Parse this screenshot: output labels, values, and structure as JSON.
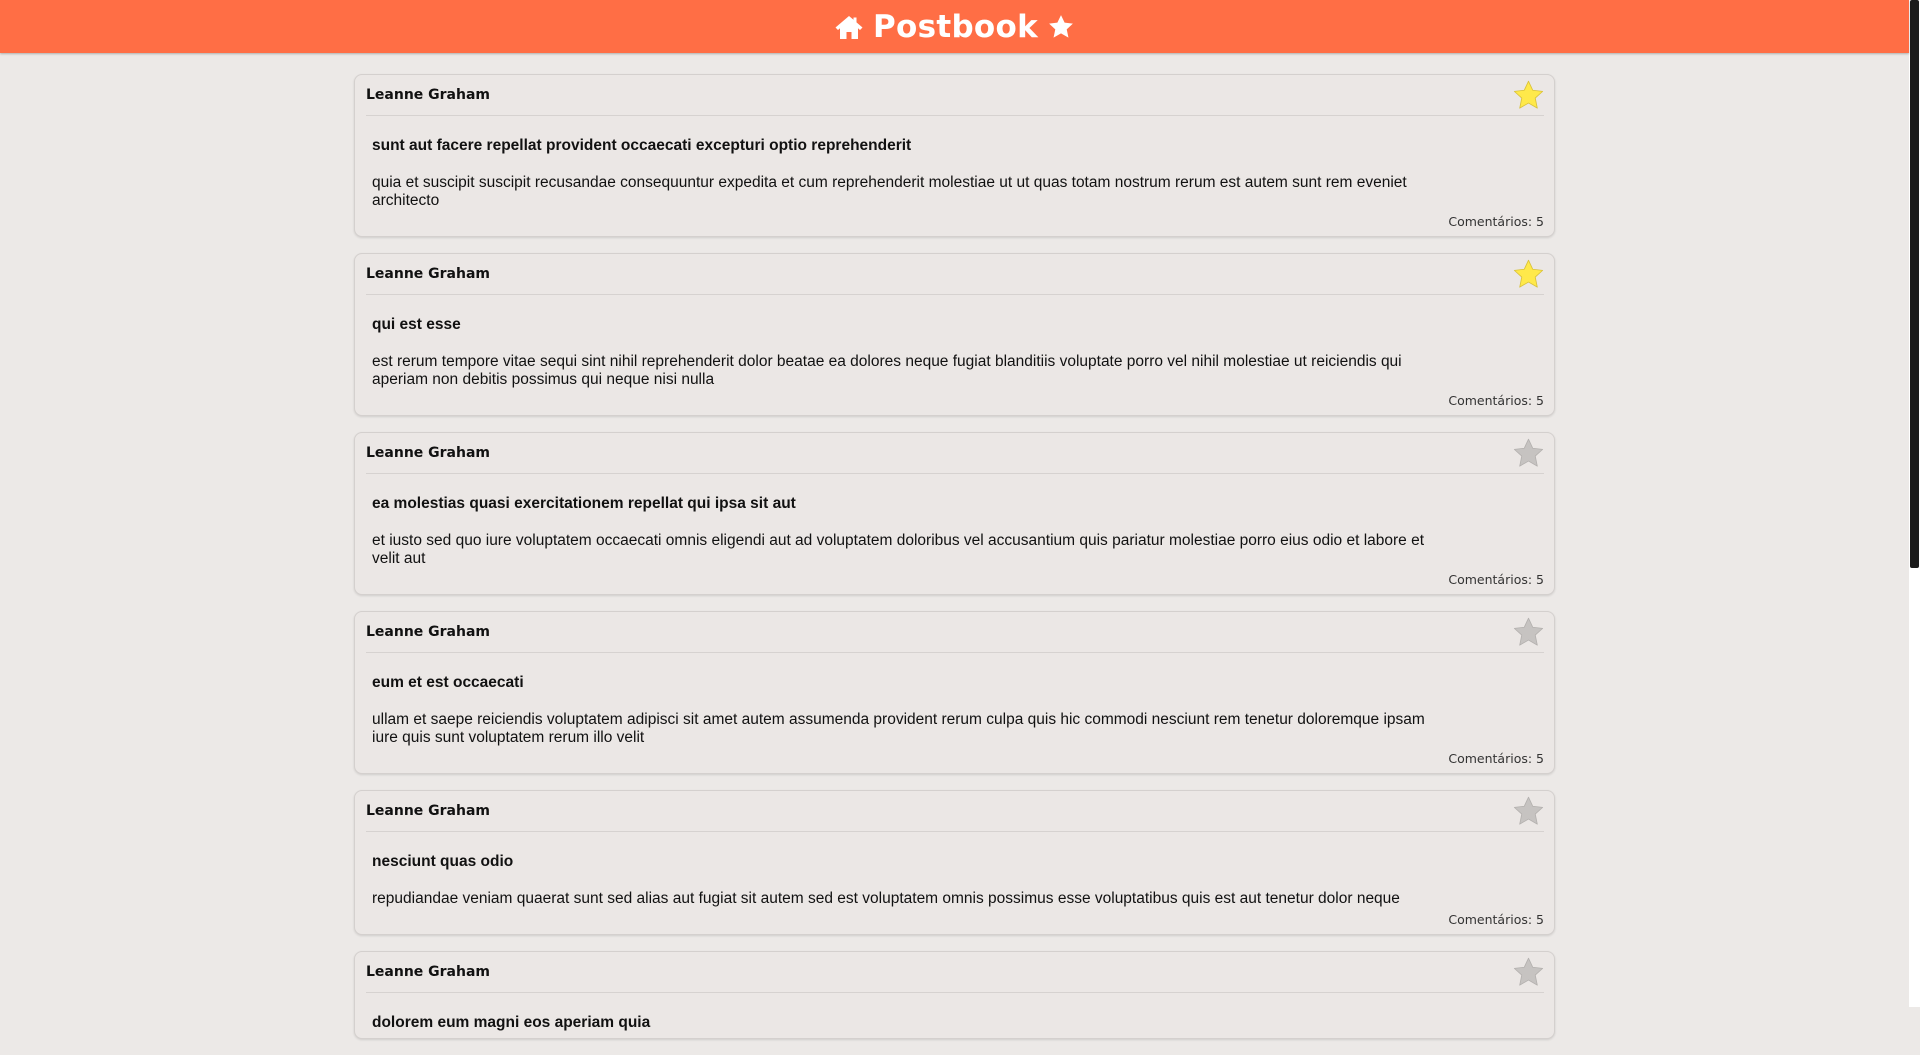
{
  "header": {
    "title": "Postbook",
    "home_icon": "home-icon",
    "star_icon": "star-icon"
  },
  "colors": {
    "header_bg": "#ff6e45",
    "page_bg": "#ece9e7",
    "card_bg": "#ebe7e5",
    "star_active": "#ffe94a",
    "star_inactive": "#c6c3c1"
  },
  "comments_label": "Comentários:",
  "posts": [
    {
      "author": "Leanne Graham",
      "favorite": true,
      "title": "sunt aut facere repellat provident occaecati excepturi optio reprehenderit",
      "body": "quia et suscipit suscipit recusandae consequuntur expedita et cum reprehenderit molestiae ut ut quas totam nostrum rerum est autem sunt rem eveniet architecto",
      "comments": "Comentários: 5"
    },
    {
      "author": "Leanne Graham",
      "favorite": true,
      "title": "qui est esse",
      "body": "est rerum tempore vitae sequi sint nihil reprehenderit dolor beatae ea dolores neque fugiat blanditiis voluptate porro vel nihil molestiae ut reiciendis qui aperiam non debitis possimus qui neque nisi nulla",
      "comments": "Comentários: 5"
    },
    {
      "author": "Leanne Graham",
      "favorite": false,
      "title": "ea molestias quasi exercitationem repellat qui ipsa sit aut",
      "body": "et iusto sed quo iure voluptatem occaecati omnis eligendi aut ad voluptatem doloribus vel accusantium quis pariatur molestiae porro eius odio et labore et velit aut",
      "comments": "Comentários: 5"
    },
    {
      "author": "Leanne Graham",
      "favorite": false,
      "title": "eum et est occaecati",
      "body": "ullam et saepe reiciendis voluptatem adipisci sit amet autem assumenda provident rerum culpa quis hic commodi nesciunt rem tenetur doloremque ipsam iure quis sunt voluptatem rerum illo velit",
      "comments": "Comentários: 5"
    },
    {
      "author": "Leanne Graham",
      "favorite": false,
      "title": "nesciunt quas odio",
      "body": "repudiandae veniam quaerat sunt sed alias aut fugiat sit autem sed est voluptatem omnis possimus esse voluptatibus quis est aut tenetur dolor neque",
      "comments": "Comentários: 5"
    },
    {
      "author": "Leanne Graham",
      "favorite": false,
      "title": "dolorem eum magni eos aperiam quia",
      "body": "",
      "comments": ""
    }
  ]
}
